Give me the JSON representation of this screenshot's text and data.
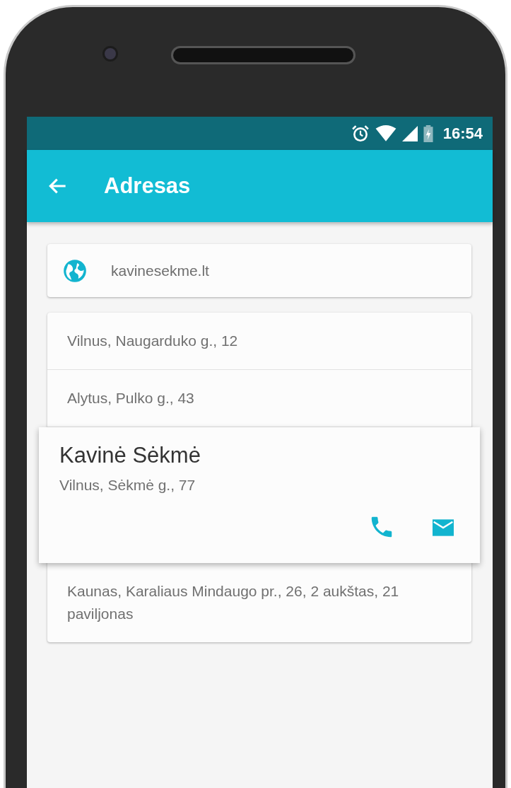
{
  "status_bar": {
    "time": "16:54"
  },
  "app_bar": {
    "title": "Adresas"
  },
  "website": {
    "text": "kavinesekme.lt"
  },
  "addresses": [
    {
      "address": "Vilnus, Naugarduko g., 12",
      "expanded": false
    },
    {
      "address": "Alytus, Pulko g., 43",
      "expanded": false
    },
    {
      "title": "Kavinė Sėkmė",
      "address": "Vilnus, Sėkmė g., 77",
      "expanded": true
    },
    {
      "address": "Kaunas, Karaliaus Mindaugo pr., 26, 2 aukštas, 21 paviljonas",
      "expanded": false
    }
  ]
}
